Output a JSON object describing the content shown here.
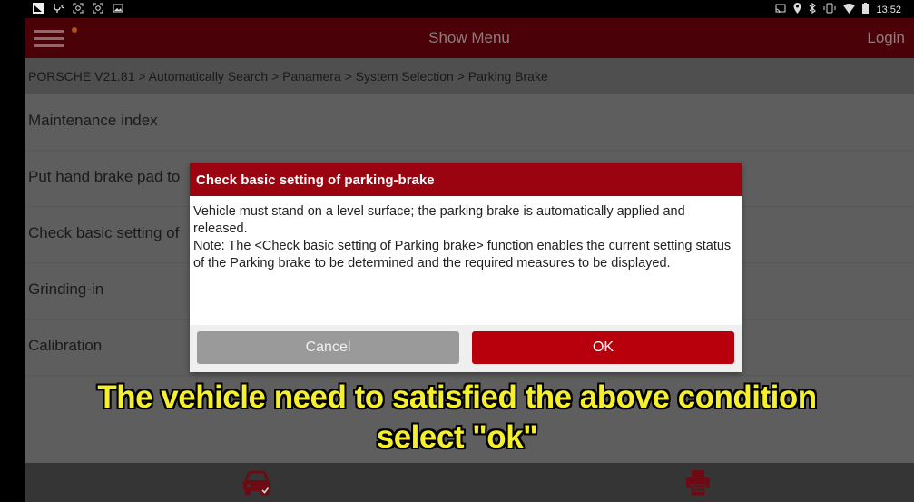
{
  "status_bar": {
    "left_icons": [
      "notification-icon",
      "usb-debug-icon",
      "screenshot-icon",
      "screenshot-icon",
      "image-icon"
    ],
    "right_icons": [
      "cast-icon",
      "location-icon",
      "bluetooth-icon",
      "vibrate-icon",
      "wifi-icon",
      "battery-icon"
    ],
    "time": "13:52"
  },
  "header": {
    "title": "Show Menu",
    "login_label": "Login"
  },
  "breadcrumb": "PORSCHE V21.81 > Automatically Search > Panamera > System Selection > Parking Brake",
  "menu_items": [
    {
      "label": "Maintenance index"
    },
    {
      "label": "Put hand brake pad to"
    },
    {
      "label": "Check basic setting of"
    },
    {
      "label": "Grinding-in"
    },
    {
      "label": "Calibration"
    }
  ],
  "dialog": {
    "title": "Check basic setting of parking-brake",
    "body_line1": "Vehicle must stand on a level surface; the parking brake is automatically applied and released.",
    "body_line2": "Note: The <Check basic setting of Parking brake> function enables the current setting status of the Parking brake to be determined and the required measures to be displayed.",
    "cancel_label": "Cancel",
    "ok_label": "OK"
  },
  "subtitle": {
    "line1": "The vehicle need to satisfied the above condition",
    "line2": "select \"ok\""
  },
  "bottom_bar": {
    "icons": [
      "car-check-icon",
      "printer-icon"
    ]
  },
  "colors": {
    "header_bg": "#4a0208",
    "dialog_header": "#9b0310",
    "ok_button": "#b8000c",
    "subtitle_text": "#f5ef2c"
  }
}
